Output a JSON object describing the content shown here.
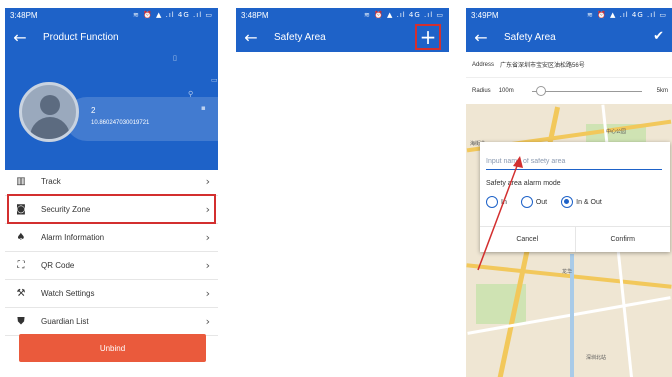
{
  "screen1": {
    "status_time": "3:48PM",
    "status_icons": "≋ ⏰ ▲ .ıl 4G .ıl ▭",
    "title": "Product Function",
    "profile": {
      "name": "2",
      "id": "10.860247030019721"
    },
    "menu": [
      {
        "label": "Track",
        "icon": "map-icon",
        "glyph": "▥"
      },
      {
        "label": "Security Zone",
        "icon": "zone-icon",
        "glyph": "◙"
      },
      {
        "label": "Alarm Information",
        "icon": "bell-icon",
        "glyph": "♠"
      },
      {
        "label": "QR Code",
        "icon": "qr-icon",
        "glyph": "⛶"
      },
      {
        "label": "Watch Settings",
        "icon": "wrench-icon",
        "glyph": "🔧"
      },
      {
        "label": "Guardian List",
        "icon": "shield-icon",
        "glyph": "⛊"
      }
    ],
    "unbind_label": "Unbind"
  },
  "screen2": {
    "status_time": "3:48PM",
    "status_icons": "≋ ⏰ ▲ .ıl 4G .ıl ▭",
    "title": "Safety Area",
    "add_glyph": "+"
  },
  "screen3": {
    "status_time": "3:49PM",
    "status_icons": "≋ ⏰ ▲ .ıl 4G .ıl ▭",
    "title": "Safety Area",
    "address_label": "Address",
    "address_value": "广东省深圳市宝安区油松路56号",
    "radius_label": "Radius",
    "radius_value": "100m",
    "radius_max": "5km",
    "map_labels": [
      "海街道",
      "中心公园",
      "龙华",
      "深圳北站"
    ],
    "dialog": {
      "placeholder": "Input name of safety area",
      "alarm_mode_label": "Safety area alarm mode",
      "options": [
        "In",
        "Out",
        "In & Out"
      ],
      "selected": "In & Out",
      "cancel": "Cancel",
      "confirm": "Confirm"
    }
  },
  "colors": {
    "primary": "#1e62c8",
    "danger": "#ea5a3c",
    "highlight": "#d32f2f"
  }
}
